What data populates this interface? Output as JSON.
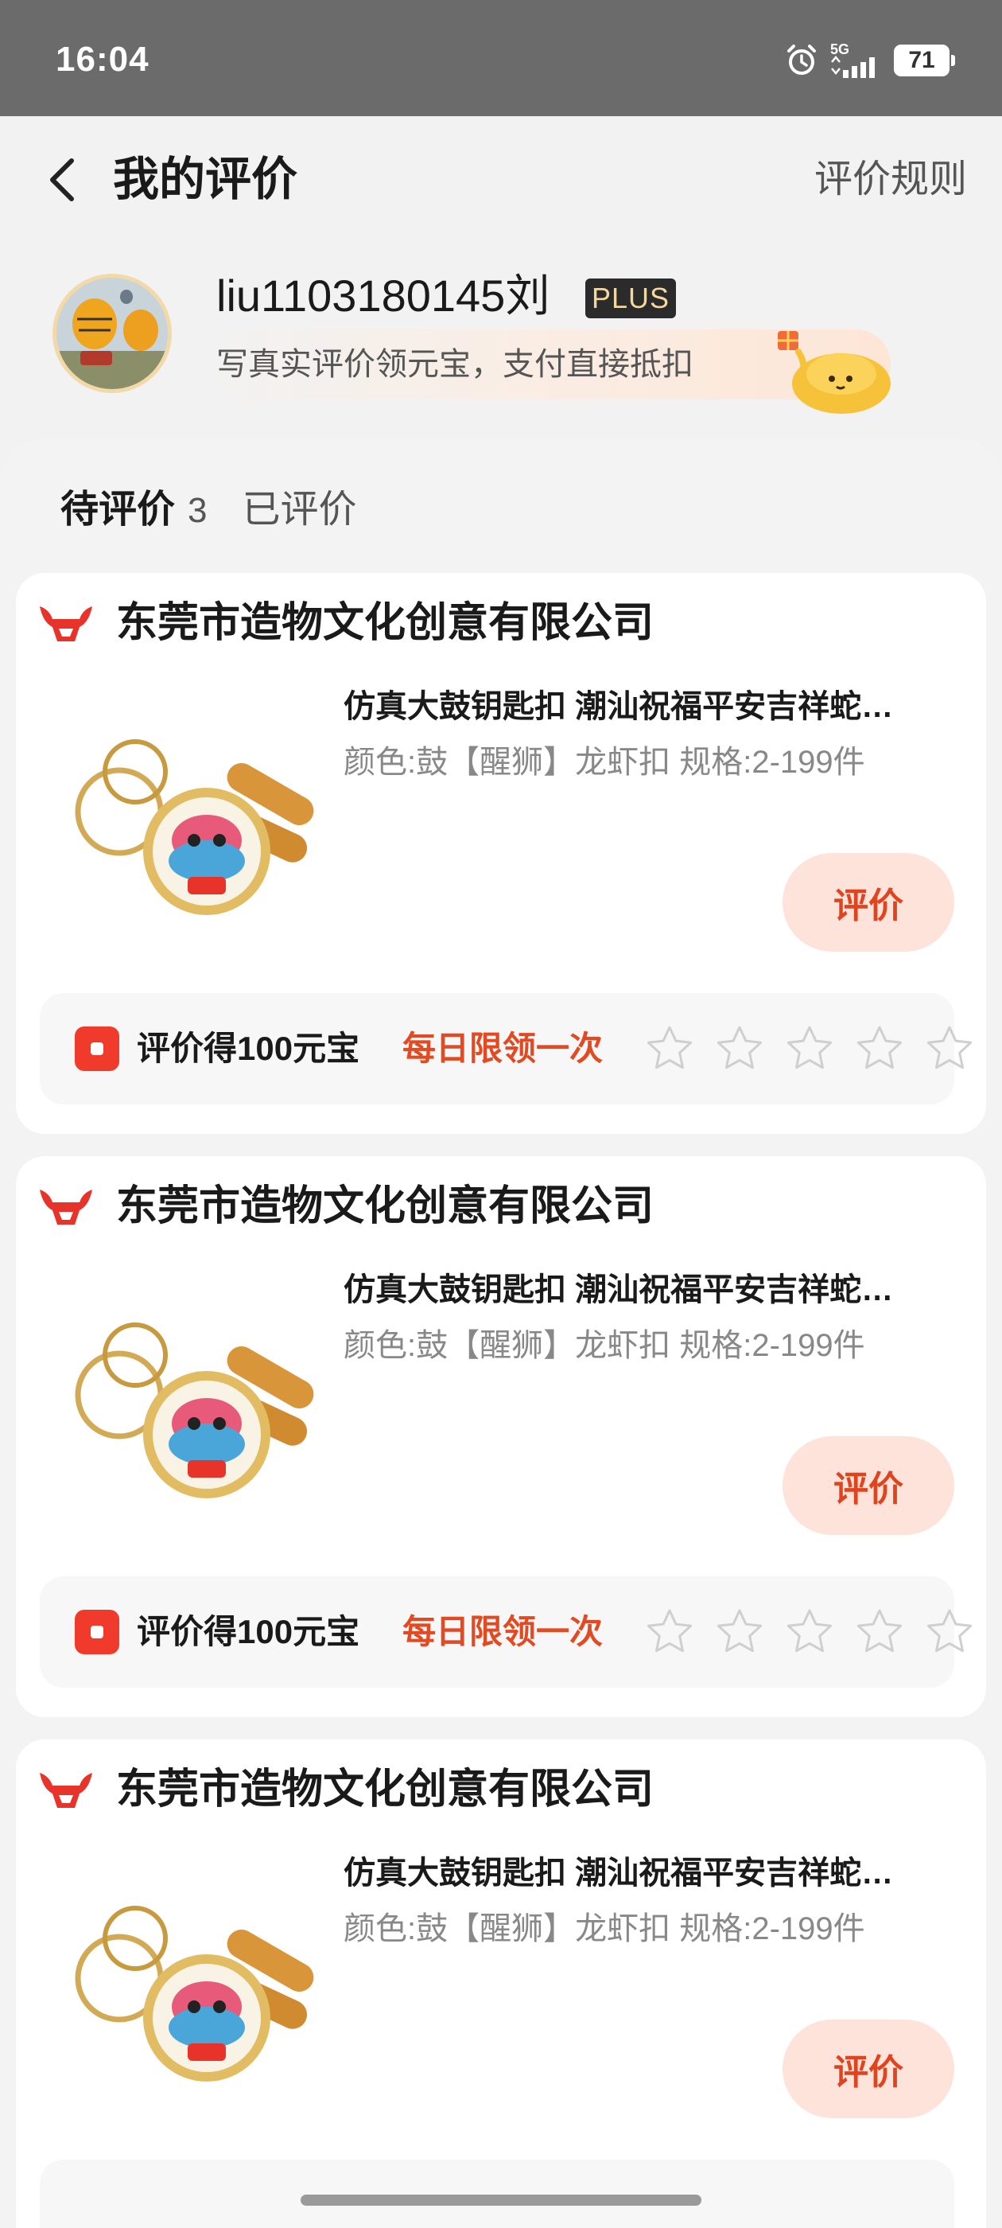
{
  "status_bar": {
    "time": "16:04",
    "network": "5G",
    "battery": "71"
  },
  "nav": {
    "title": "我的评价",
    "rules_link": "评价规则"
  },
  "profile": {
    "username": "liu1103180145刘",
    "badge": "PLUS",
    "promo_text": "写真实评价领元宝，支付直接抵扣"
  },
  "tabs": {
    "pending_label": "待评价",
    "pending_count": "3",
    "done_label": "已评价"
  },
  "orders": [
    {
      "shop_name": "东莞市造物文化创意有限公司",
      "product_title": "仿真大鼓钥匙扣 潮汕祝福平安吉祥蛇…",
      "product_spec": "颜色:鼓【醒狮】龙虾扣  规格:2-199件",
      "review_button": "评价",
      "reward_text": "评价得100元宝",
      "reward_limit": "每日限领一次",
      "stars_total": 5
    },
    {
      "shop_name": "东莞市造物文化创意有限公司",
      "product_title": "仿真大鼓钥匙扣 潮汕祝福平安吉祥蛇…",
      "product_spec": "颜色:鼓【醒狮】龙虾扣  规格:2-199件",
      "review_button": "评价",
      "reward_text": "评价得100元宝",
      "reward_limit": "每日限领一次",
      "stars_total": 5
    },
    {
      "shop_name": "东莞市造物文化创意有限公司",
      "product_title": "仿真大鼓钥匙扣 潮汕祝福平安吉祥蛇…",
      "product_spec": "颜色:鼓【醒狮】龙虾扣  规格:2-199件",
      "review_button": "评价"
    }
  ],
  "colors": {
    "accent": "#e24a22",
    "button_bg": "#fde3da",
    "shop_icon": "#e8332a"
  }
}
